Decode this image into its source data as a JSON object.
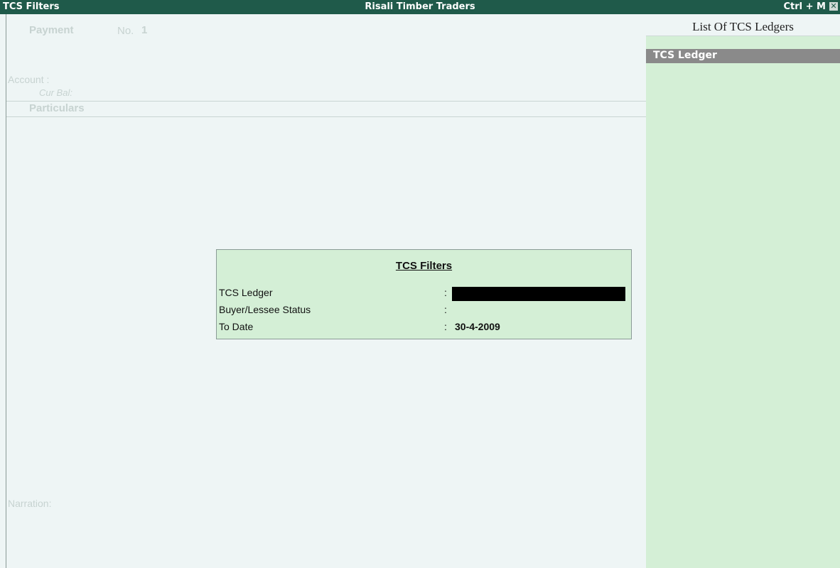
{
  "titlebar": {
    "screen_name": "TCS Filters",
    "company": "Risali Timber Traders",
    "shortcut": "Ctrl + M",
    "close_glyph": "✕"
  },
  "voucher": {
    "type": "Payment",
    "no_label": "No.",
    "no_value": "1",
    "account_label": "Account :",
    "cur_bal_label": "Cur Bal:",
    "particulars_label": "Particulars",
    "narration_label": "Narration:"
  },
  "side_panel": {
    "title": "List Of TCS Ledgers",
    "header": "TCS Ledger"
  },
  "dialog": {
    "title": "TCS Filters",
    "fields": [
      {
        "label": "TCS Ledger",
        "colon": ":",
        "value": ""
      },
      {
        "label": "Buyer/Lessee Status",
        "colon": ":",
        "value": ""
      },
      {
        "label": "To Date",
        "colon": ":",
        "value": "30-4-2009"
      }
    ]
  },
  "colors": {
    "titlebar_bg": "#1f5a4a",
    "panel_bg": "#d4efd6",
    "page_bg": "#eef5f5"
  }
}
